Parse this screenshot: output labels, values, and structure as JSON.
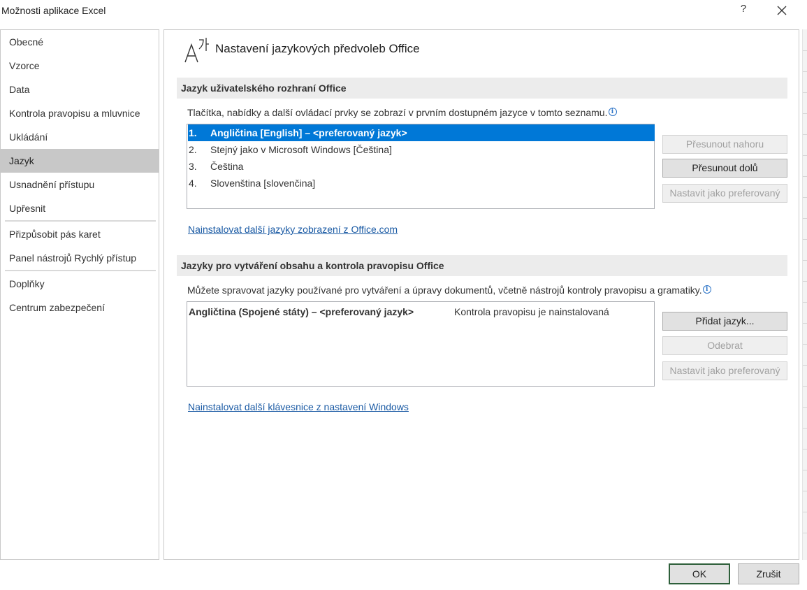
{
  "window": {
    "title": "Možnosti aplikace Excel",
    "help": "?",
    "close_icon": "close-icon"
  },
  "sidebar": {
    "items": [
      {
        "label": "Obecné"
      },
      {
        "label": "Vzorce"
      },
      {
        "label": "Data"
      },
      {
        "label": "Kontrola pravopisu a mluvnice"
      },
      {
        "label": "Ukládání"
      },
      {
        "label": "Jazyk",
        "selected": true
      },
      {
        "label": "Usnadnění přístupu"
      },
      {
        "label": "Upřesnit"
      },
      {
        "label": "Přizpůsobit pás karet"
      },
      {
        "label": "Panel nástrojů Rychlý přístup"
      },
      {
        "label": "Doplňky"
      },
      {
        "label": "Centrum zabezpečení"
      }
    ]
  },
  "page": {
    "title": "Nastavení jazykových předvoleb Office",
    "icon": "language-icon"
  },
  "ui_language": {
    "header": "Jazyk uživatelského rozhraní Office",
    "description": "Tlačítka, nabídky a další ovládací prvky se zobrazí v prvním dostupném jazyce v tomto seznamu.",
    "languages": [
      {
        "num": "1.",
        "label": "Angličtina [English] – <preferovaný jazyk>",
        "selected": true
      },
      {
        "num": "2.",
        "label": "Stejný jako v Microsoft Windows [Čeština]"
      },
      {
        "num": "3.",
        "label": "Čeština"
      },
      {
        "num": "4.",
        "label": "Slovenština [slovenčina]"
      }
    ],
    "buttons": {
      "move_up": "Přesunout nahoru",
      "move_down": "Přesunout dolů",
      "set_preferred": "Nastavit jako preferovaný"
    },
    "link": "Nainstalovat další jazyky zobrazení z Office.com"
  },
  "authoring_language": {
    "header": "Jazyky pro vytváření obsahu a kontrola pravopisu Office",
    "description": "Můžete spravovat jazyky používané pro vytváření a úpravy dokumentů, včetně nástrojů kontroly pravopisu a gramatiky.",
    "languages": [
      {
        "label": "Angličtina (Spojené státy) – <preferovaný jazyk>",
        "status": "Kontrola pravopisu je nainstalovaná"
      }
    ],
    "buttons": {
      "add": "Přidat jazyk...",
      "remove": "Odebrat",
      "set_preferred": "Nastavit jako preferovaný"
    },
    "link": "Nainstalovat další klávesnice z nastavení Windows"
  },
  "footer": {
    "ok": "OK",
    "cancel": "Zrušit"
  },
  "colors": {
    "selection": "#0078d7",
    "nav_selected": "#c8c8c8",
    "link": "#1a5aa4"
  }
}
